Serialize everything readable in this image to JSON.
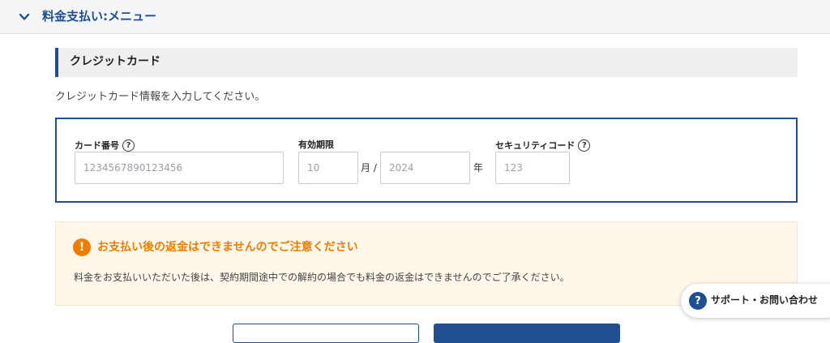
{
  "header": {
    "title": "料金支払い:メニュー",
    "toggle_icon": "chevron-down-icon"
  },
  "section": {
    "title": "クレジットカード",
    "instruction": "クレジットカード情報を入力してください。"
  },
  "form": {
    "card_number": {
      "label": "カード番号",
      "placeholder": "1234567890123456"
    },
    "expiry": {
      "label": "有効期限",
      "month_placeholder": "10",
      "month_unit": "月 /",
      "year_placeholder": "2024",
      "year_unit": "年"
    },
    "security_code": {
      "label": "セキュリティコード",
      "placeholder": "123"
    },
    "help_icon_glyph": "?"
  },
  "notice": {
    "icon_glyph": "!",
    "title": "お支払い後の返金はできませんのでご注意ください",
    "body": "料金をお支払いいただいた後は、契約期間途中での解約の場合でも料金の返金はできませんのでご了承ください。"
  },
  "support": {
    "icon_glyph": "?",
    "label": "サポート・お問い合わせ"
  },
  "colors": {
    "brand": "#1d4f91",
    "warning": "#ef7d00",
    "warning_bg": "#fff7ea"
  }
}
